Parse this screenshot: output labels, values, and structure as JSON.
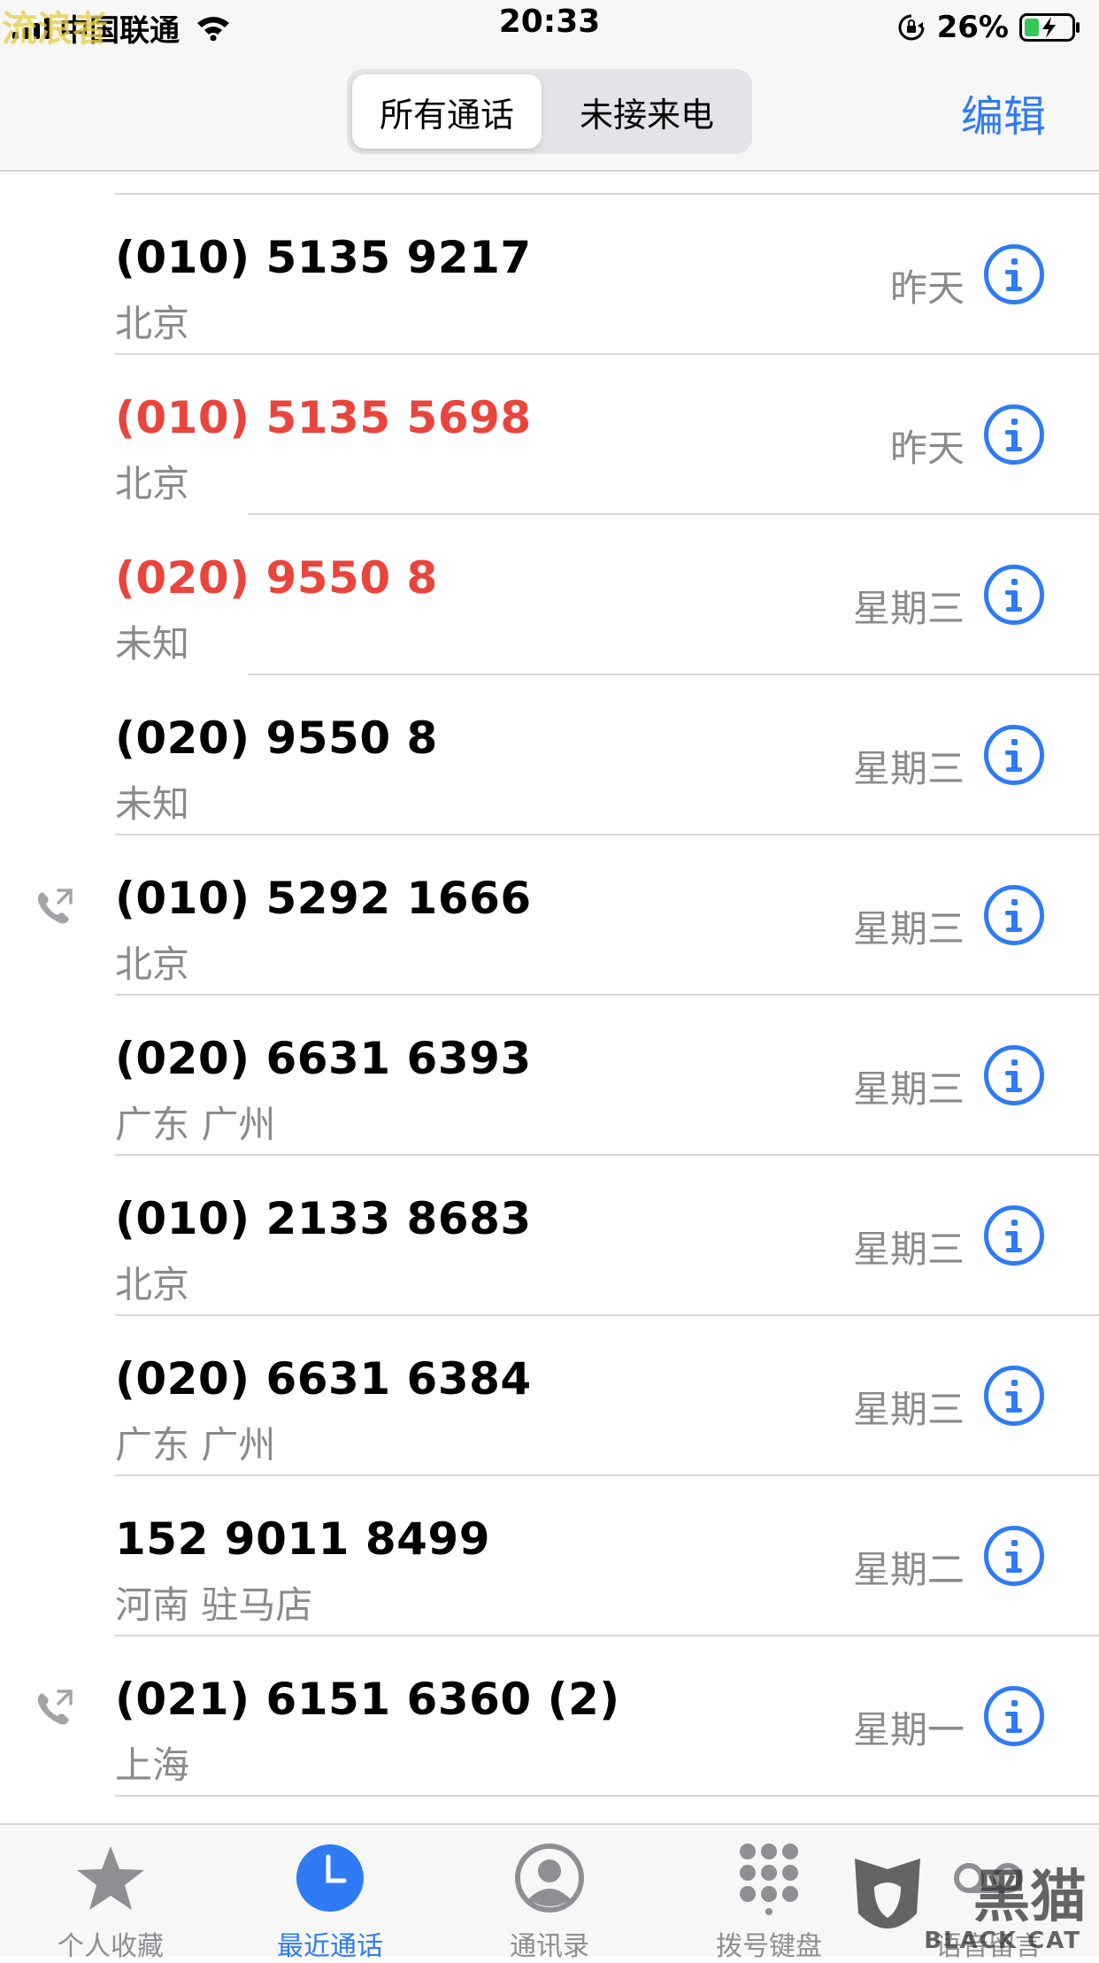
{
  "status_bar": {
    "carrier": "中国联通",
    "time": "20:33",
    "battery_percent": "26%"
  },
  "nav": {
    "segments": [
      {
        "label": "所有通话",
        "active": true
      },
      {
        "label": "未接来电",
        "active": false
      }
    ],
    "edit_label": "编辑"
  },
  "calls": [
    {
      "number": "(010) 5135 9217",
      "location": "北京",
      "date": "昨天",
      "missed": false,
      "outgoing": false
    },
    {
      "number": "(010) 5135 5698",
      "location": "北京",
      "date": "昨天",
      "missed": true,
      "outgoing": false
    },
    {
      "number": "(020) 9550 8",
      "location": "未知",
      "date": "星期三",
      "missed": true,
      "outgoing": false
    },
    {
      "number": "(020) 9550 8",
      "location": "未知",
      "date": "星期三",
      "missed": false,
      "outgoing": false
    },
    {
      "number": "(010) 5292 1666",
      "location": "北京",
      "date": "星期三",
      "missed": false,
      "outgoing": true
    },
    {
      "number": "(020) 6631 6393",
      "location": "广东 广州",
      "date": "星期三",
      "missed": false,
      "outgoing": false
    },
    {
      "number": "(010) 2133 8683",
      "location": "北京",
      "date": "星期三",
      "missed": false,
      "outgoing": false
    },
    {
      "number": "(020) 6631 6384",
      "location": "广东 广州",
      "date": "星期三",
      "missed": false,
      "outgoing": false
    },
    {
      "number": "152 9011 8499",
      "location": "河南 驻马店",
      "date": "星期二",
      "missed": false,
      "outgoing": false
    },
    {
      "number": "(021) 6151 6360 (2)",
      "location": "上海",
      "date": "星期一",
      "missed": false,
      "outgoing": true
    }
  ],
  "tabs": [
    {
      "label": "个人收藏",
      "icon": "star-icon",
      "active": false
    },
    {
      "label": "最近通话",
      "icon": "clock-icon",
      "active": true
    },
    {
      "label": "通讯录",
      "icon": "contacts-icon",
      "active": false
    },
    {
      "label": "拨号键盘",
      "icon": "keypad-icon",
      "active": false
    },
    {
      "label": "语音留言",
      "icon": "voicemail-icon",
      "active": false
    }
  ],
  "watermarks": {
    "top_left": "流浪者",
    "bottom_right_cn": "黑猫",
    "bottom_right_en": "BLACK CAT"
  },
  "colors": {
    "accent": "#2f7bf5",
    "missed": "#e8453c",
    "secondary_text": "#8a8a8e"
  }
}
